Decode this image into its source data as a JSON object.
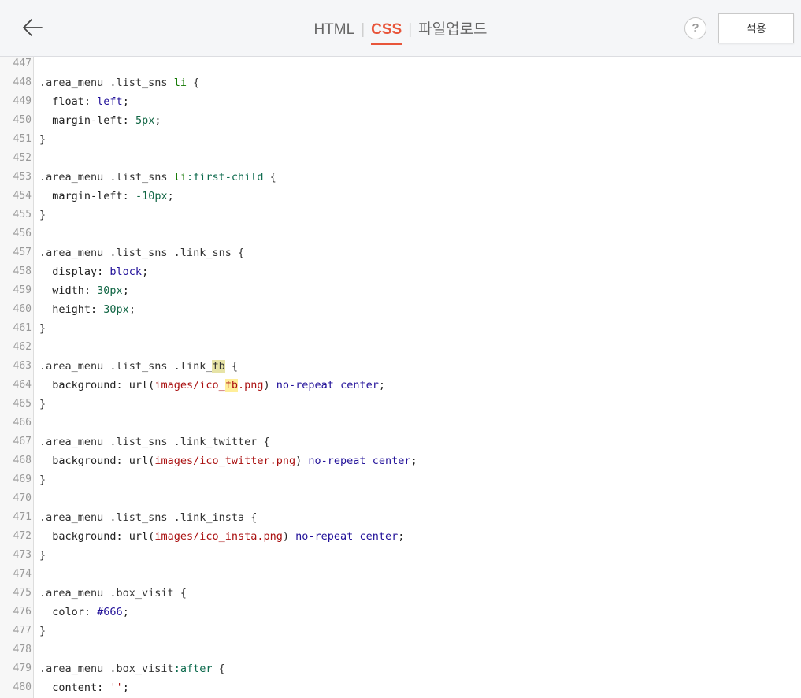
{
  "header": {
    "tabs": [
      {
        "label": "HTML",
        "active": false
      },
      {
        "label": "CSS",
        "active": true
      },
      {
        "label": "파일업로드",
        "active": false
      }
    ],
    "help_label": "?",
    "apply_label": "적용"
  },
  "colors": {
    "accent": "#e8553a",
    "selector": "#333333",
    "tag": "#117700",
    "atom": "#221199",
    "number": "#116644",
    "string": "#aa1111",
    "search_highlight": "#ffee99"
  },
  "editor": {
    "lines": [
      {
        "n": "447",
        "tokens": []
      },
      {
        "n": "448",
        "tokens": [
          {
            "t": ".area_menu .list_sns ",
            "c": "sel"
          },
          {
            "t": "li",
            "c": "tag"
          },
          {
            "t": " {",
            "c": "sel"
          }
        ]
      },
      {
        "n": "449",
        "tokens": [
          {
            "t": "  float",
            "c": "prop"
          },
          {
            "t": ": ",
            "c": "prop"
          },
          {
            "t": "left",
            "c": "atom"
          },
          {
            "t": ";",
            "c": "prop"
          }
        ]
      },
      {
        "n": "450",
        "tokens": [
          {
            "t": "  margin-left",
            "c": "prop"
          },
          {
            "t": ": ",
            "c": "prop"
          },
          {
            "t": "5px",
            "c": "num"
          },
          {
            "t": ";",
            "c": "prop"
          }
        ]
      },
      {
        "n": "451",
        "tokens": [
          {
            "t": "}",
            "c": "sel"
          }
        ]
      },
      {
        "n": "452",
        "tokens": []
      },
      {
        "n": "453",
        "tokens": [
          {
            "t": ".area_menu .list_sns ",
            "c": "sel"
          },
          {
            "t": "li",
            "c": "tag"
          },
          {
            "t": ":first-child",
            "c": "pseudo"
          },
          {
            "t": " {",
            "c": "sel"
          }
        ]
      },
      {
        "n": "454",
        "tokens": [
          {
            "t": "  margin-left",
            "c": "prop"
          },
          {
            "t": ": ",
            "c": "prop"
          },
          {
            "t": "-10px",
            "c": "num"
          },
          {
            "t": ";",
            "c": "prop"
          }
        ]
      },
      {
        "n": "455",
        "tokens": [
          {
            "t": "}",
            "c": "sel"
          }
        ]
      },
      {
        "n": "456",
        "tokens": []
      },
      {
        "n": "457",
        "tokens": [
          {
            "t": ".area_menu .list_sns .link_sns {",
            "c": "sel"
          }
        ]
      },
      {
        "n": "458",
        "tokens": [
          {
            "t": "  display",
            "c": "prop"
          },
          {
            "t": ": ",
            "c": "prop"
          },
          {
            "t": "block",
            "c": "atom"
          },
          {
            "t": ";",
            "c": "prop"
          }
        ]
      },
      {
        "n": "459",
        "tokens": [
          {
            "t": "  width",
            "c": "prop"
          },
          {
            "t": ": ",
            "c": "prop"
          },
          {
            "t": "30px",
            "c": "num"
          },
          {
            "t": ";",
            "c": "prop"
          }
        ]
      },
      {
        "n": "460",
        "tokens": [
          {
            "t": "  height",
            "c": "prop"
          },
          {
            "t": ": ",
            "c": "prop"
          },
          {
            "t": "30px",
            "c": "num"
          },
          {
            "t": ";",
            "c": "prop"
          }
        ]
      },
      {
        "n": "461",
        "tokens": [
          {
            "t": "}",
            "c": "sel"
          }
        ]
      },
      {
        "n": "462",
        "tokens": []
      },
      {
        "n": "463",
        "tokens": [
          {
            "t": ".area_menu .list_sns .link_",
            "c": "sel"
          },
          {
            "t": "fb",
            "c": "sel hl2"
          },
          {
            "t": " {",
            "c": "sel"
          }
        ]
      },
      {
        "n": "464",
        "tokens": [
          {
            "t": "  background",
            "c": "prop"
          },
          {
            "t": ": url(",
            "c": "prop"
          },
          {
            "t": "images/ico_",
            "c": "str"
          },
          {
            "t": "fb",
            "c": "str hl"
          },
          {
            "t": ".png",
            "c": "str"
          },
          {
            "t": ") ",
            "c": "prop"
          },
          {
            "t": "no-repeat",
            "c": "atom"
          },
          {
            "t": " ",
            "c": "prop"
          },
          {
            "t": "center",
            "c": "atom"
          },
          {
            "t": ";",
            "c": "prop"
          }
        ]
      },
      {
        "n": "465",
        "tokens": [
          {
            "t": "}",
            "c": "sel"
          }
        ]
      },
      {
        "n": "466",
        "tokens": []
      },
      {
        "n": "467",
        "tokens": [
          {
            "t": ".area_menu .list_sns .link_twitter {",
            "c": "sel"
          }
        ]
      },
      {
        "n": "468",
        "tokens": [
          {
            "t": "  background",
            "c": "prop"
          },
          {
            "t": ": url(",
            "c": "prop"
          },
          {
            "t": "images/ico_twitter.png",
            "c": "str"
          },
          {
            "t": ") ",
            "c": "prop"
          },
          {
            "t": "no-repeat",
            "c": "atom"
          },
          {
            "t": " ",
            "c": "prop"
          },
          {
            "t": "center",
            "c": "atom"
          },
          {
            "t": ";",
            "c": "prop"
          }
        ]
      },
      {
        "n": "469",
        "tokens": [
          {
            "t": "}",
            "c": "sel"
          }
        ]
      },
      {
        "n": "470",
        "tokens": []
      },
      {
        "n": "471",
        "tokens": [
          {
            "t": ".area_menu .list_sns .link_insta {",
            "c": "sel"
          }
        ]
      },
      {
        "n": "472",
        "tokens": [
          {
            "t": "  background",
            "c": "prop"
          },
          {
            "t": ": url(",
            "c": "prop"
          },
          {
            "t": "images/ico_insta.png",
            "c": "str"
          },
          {
            "t": ") ",
            "c": "prop"
          },
          {
            "t": "no-repeat",
            "c": "atom"
          },
          {
            "t": " ",
            "c": "prop"
          },
          {
            "t": "center",
            "c": "atom"
          },
          {
            "t": ";",
            "c": "prop"
          }
        ]
      },
      {
        "n": "473",
        "tokens": [
          {
            "t": "}",
            "c": "sel"
          }
        ]
      },
      {
        "n": "474",
        "tokens": []
      },
      {
        "n": "475",
        "tokens": [
          {
            "t": ".area_menu .box_visit {",
            "c": "sel"
          }
        ]
      },
      {
        "n": "476",
        "tokens": [
          {
            "t": "  color",
            "c": "prop"
          },
          {
            "t": ": ",
            "c": "prop"
          },
          {
            "t": "#666",
            "c": "hash"
          },
          {
            "t": ";",
            "c": "prop"
          }
        ]
      },
      {
        "n": "477",
        "tokens": [
          {
            "t": "}",
            "c": "sel"
          }
        ]
      },
      {
        "n": "478",
        "tokens": []
      },
      {
        "n": "479",
        "tokens": [
          {
            "t": ".area_menu .box_visit",
            "c": "sel"
          },
          {
            "t": ":after",
            "c": "pseudo"
          },
          {
            "t": " {",
            "c": "sel"
          }
        ]
      },
      {
        "n": "480",
        "tokens": [
          {
            "t": "  content",
            "c": "prop"
          },
          {
            "t": ": ",
            "c": "prop"
          },
          {
            "t": "''",
            "c": "str"
          },
          {
            "t": ";",
            "c": "prop"
          }
        ]
      }
    ]
  }
}
